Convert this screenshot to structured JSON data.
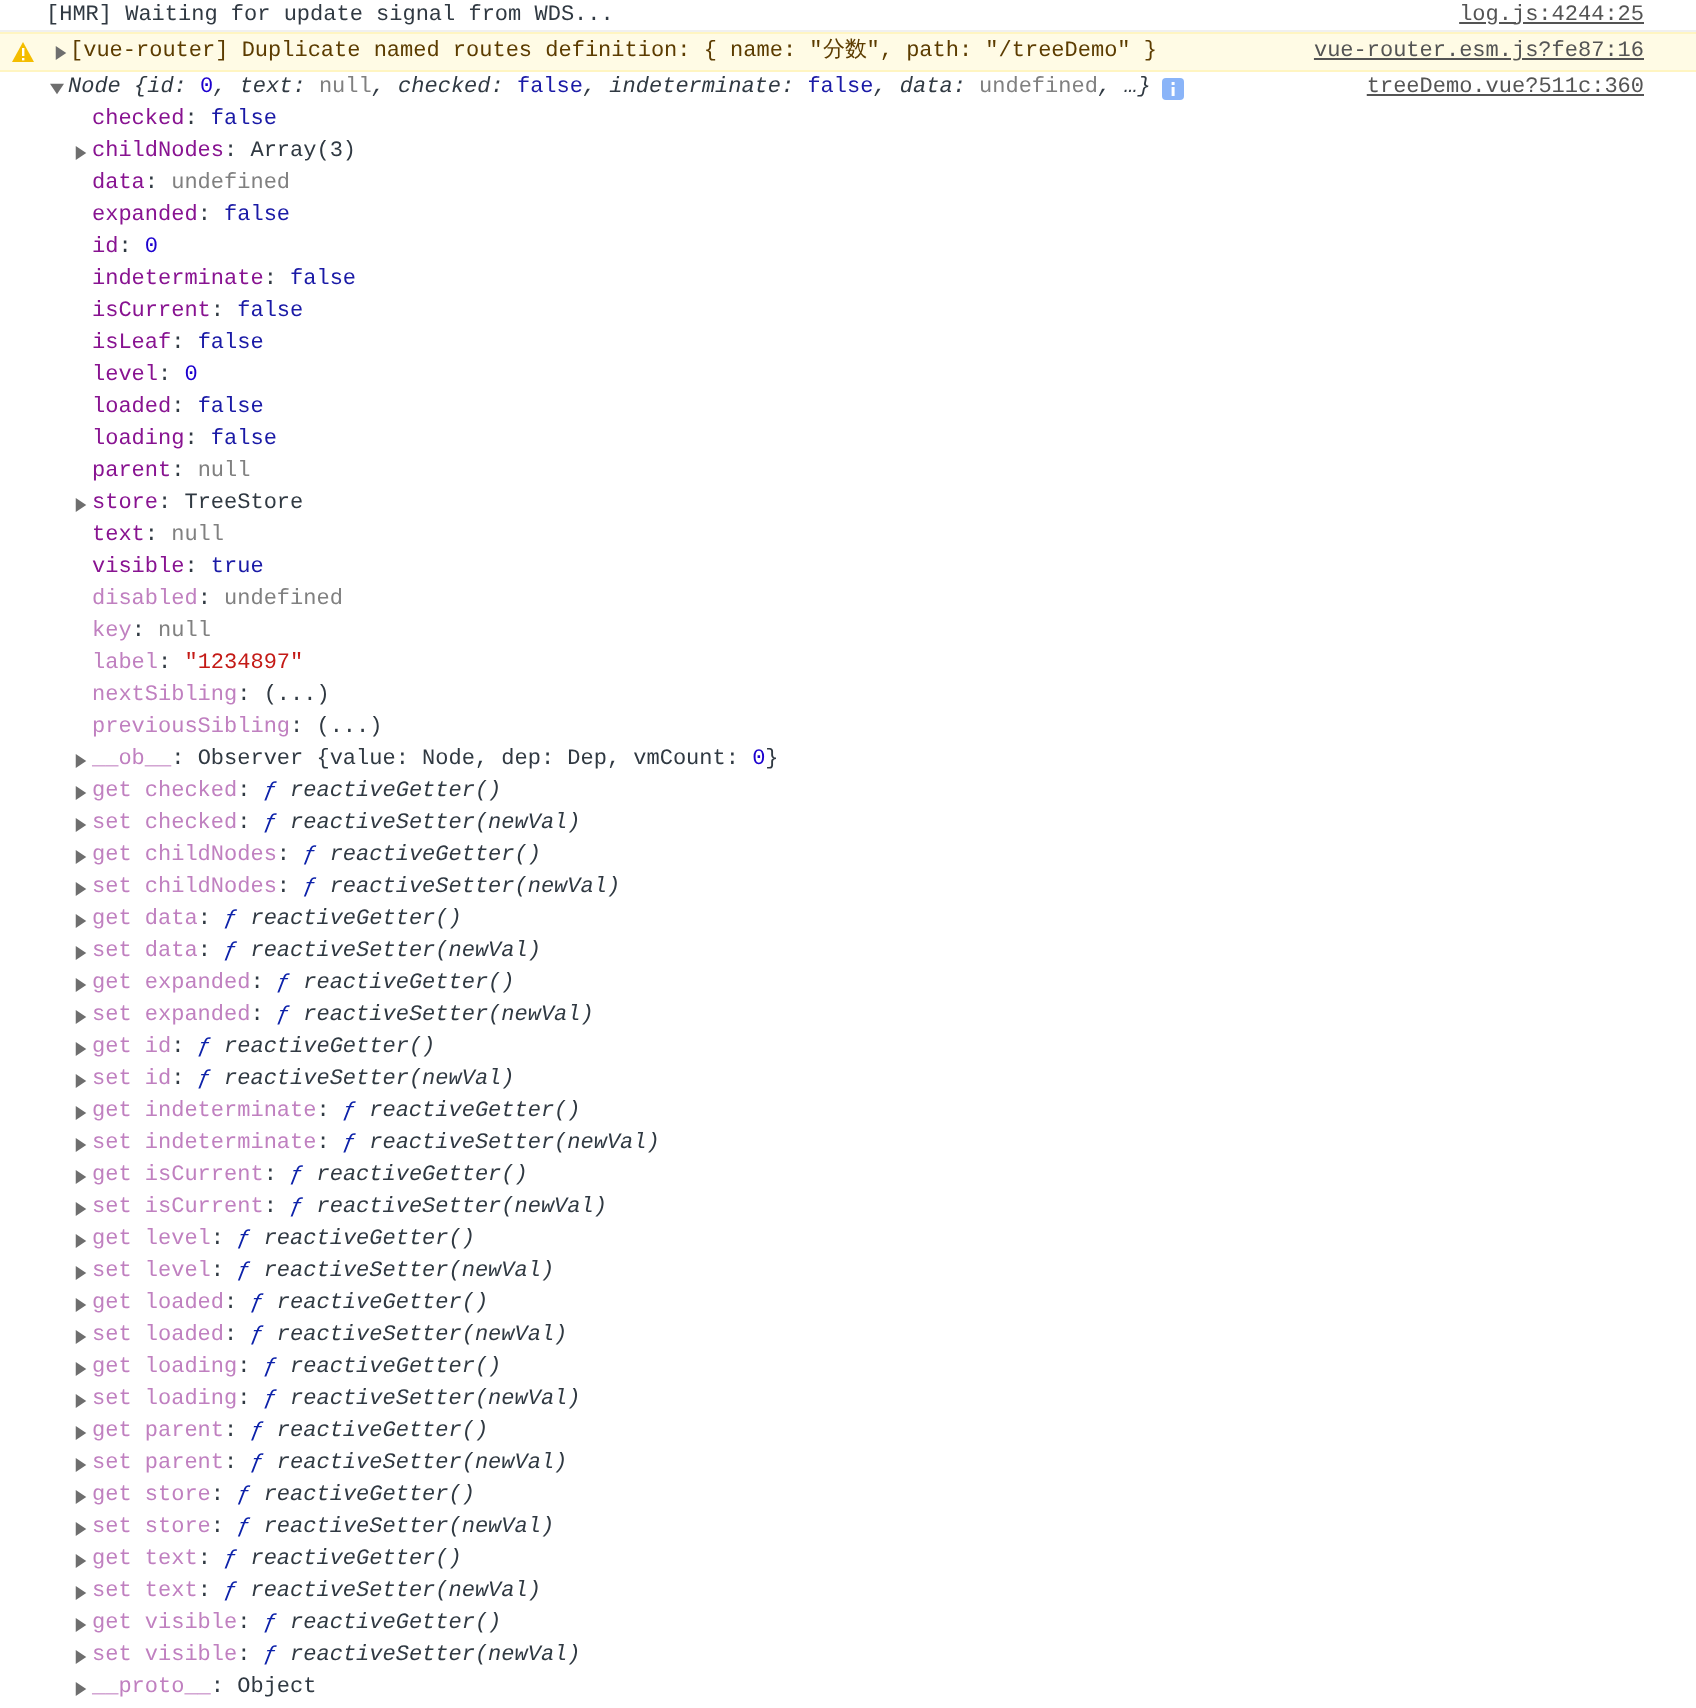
{
  "messages": [
    {
      "kind": "log",
      "text": "[HMR] Waiting for update signal from WDS...",
      "source": "log.js:4244:25"
    },
    {
      "kind": "warning",
      "expandable": true,
      "text": "[vue-router] Duplicate named routes definition: { name: \"分数\", path: \"/treeDemo\" }",
      "source": "vue-router.esm.js?fe87:16"
    },
    {
      "kind": "object",
      "expanded": true,
      "info": true,
      "source": "treeDemo.vue?511c:360",
      "summary": [
        {
          "kind": "cls",
          "text": "Node {"
        },
        {
          "kind": "pkey",
          "text": "id: "
        },
        {
          "kind": "num",
          "text": "0"
        },
        {
          "kind": "pkey",
          "text": ", text: "
        },
        {
          "kind": "null",
          "text": "null"
        },
        {
          "kind": "pkey",
          "text": ", checked: "
        },
        {
          "kind": "bool",
          "text": "false"
        },
        {
          "kind": "pkey",
          "text": ", indeterminate: "
        },
        {
          "kind": "bool",
          "text": "false"
        },
        {
          "kind": "pkey",
          "text": ", data: "
        },
        {
          "kind": "null",
          "text": "undefined"
        },
        {
          "kind": "pkey",
          "text": ", …}"
        }
      ],
      "properties": [
        {
          "expandable": false,
          "tokens": [
            {
              "kind": "key",
              "text": "checked"
            },
            {
              "kind": "punct",
              "text": ": "
            },
            {
              "kind": "bool",
              "text": "false"
            }
          ]
        },
        {
          "expandable": true,
          "tokens": [
            {
              "kind": "key",
              "text": "childNodes"
            },
            {
              "kind": "punct",
              "text": ": "
            },
            {
              "kind": "obj",
              "text": "Array(3)"
            }
          ]
        },
        {
          "expandable": false,
          "tokens": [
            {
              "kind": "key",
              "text": "data"
            },
            {
              "kind": "punct",
              "text": ": "
            },
            {
              "kind": "null",
              "text": "undefined"
            }
          ]
        },
        {
          "expandable": false,
          "tokens": [
            {
              "kind": "key",
              "text": "expanded"
            },
            {
              "kind": "punct",
              "text": ": "
            },
            {
              "kind": "bool",
              "text": "false"
            }
          ]
        },
        {
          "expandable": false,
          "tokens": [
            {
              "kind": "key",
              "text": "id"
            },
            {
              "kind": "punct",
              "text": ": "
            },
            {
              "kind": "num",
              "text": "0"
            }
          ]
        },
        {
          "expandable": false,
          "tokens": [
            {
              "kind": "key",
              "text": "indeterminate"
            },
            {
              "kind": "punct",
              "text": ": "
            },
            {
              "kind": "bool",
              "text": "false"
            }
          ]
        },
        {
          "expandable": false,
          "tokens": [
            {
              "kind": "key",
              "text": "isCurrent"
            },
            {
              "kind": "punct",
              "text": ": "
            },
            {
              "kind": "bool",
              "text": "false"
            }
          ]
        },
        {
          "expandable": false,
          "tokens": [
            {
              "kind": "key",
              "text": "isLeaf"
            },
            {
              "kind": "punct",
              "text": ": "
            },
            {
              "kind": "bool",
              "text": "false"
            }
          ]
        },
        {
          "expandable": false,
          "tokens": [
            {
              "kind": "key",
              "text": "level"
            },
            {
              "kind": "punct",
              "text": ": "
            },
            {
              "kind": "num",
              "text": "0"
            }
          ]
        },
        {
          "expandable": false,
          "tokens": [
            {
              "kind": "key",
              "text": "loaded"
            },
            {
              "kind": "punct",
              "text": ": "
            },
            {
              "kind": "bool",
              "text": "false"
            }
          ]
        },
        {
          "expandable": false,
          "tokens": [
            {
              "kind": "key",
              "text": "loading"
            },
            {
              "kind": "punct",
              "text": ": "
            },
            {
              "kind": "bool",
              "text": "false"
            }
          ]
        },
        {
          "expandable": false,
          "tokens": [
            {
              "kind": "key",
              "text": "parent"
            },
            {
              "kind": "punct",
              "text": ": "
            },
            {
              "kind": "null",
              "text": "null"
            }
          ]
        },
        {
          "expandable": true,
          "tokens": [
            {
              "kind": "key",
              "text": "store"
            },
            {
              "kind": "punct",
              "text": ": "
            },
            {
              "kind": "obj",
              "text": "TreeStore"
            }
          ]
        },
        {
          "expandable": false,
          "tokens": [
            {
              "kind": "key",
              "text": "text"
            },
            {
              "kind": "punct",
              "text": ": "
            },
            {
              "kind": "null",
              "text": "null"
            }
          ]
        },
        {
          "expandable": false,
          "tokens": [
            {
              "kind": "key",
              "text": "visible"
            },
            {
              "kind": "punct",
              "text": ": "
            },
            {
              "kind": "bool",
              "text": "true"
            }
          ]
        },
        {
          "expandable": false,
          "tokens": [
            {
              "kind": "dimkey",
              "text": "disabled"
            },
            {
              "kind": "punct",
              "text": ": "
            },
            {
              "kind": "null",
              "text": "undefined"
            }
          ]
        },
        {
          "expandable": false,
          "tokens": [
            {
              "kind": "dimkey",
              "text": "key"
            },
            {
              "kind": "punct",
              "text": ": "
            },
            {
              "kind": "null",
              "text": "null"
            }
          ]
        },
        {
          "expandable": false,
          "tokens": [
            {
              "kind": "dimkey",
              "text": "label"
            },
            {
              "kind": "punct",
              "text": ": "
            },
            {
              "kind": "str",
              "text": "\"1234897\""
            }
          ]
        },
        {
          "expandable": false,
          "tokens": [
            {
              "kind": "dimkey",
              "text": "nextSibling"
            },
            {
              "kind": "punct",
              "text": ": "
            },
            {
              "kind": "obj",
              "text": "(...)"
            }
          ]
        },
        {
          "expandable": false,
          "tokens": [
            {
              "kind": "dimkey",
              "text": "previousSibling"
            },
            {
              "kind": "punct",
              "text": ": "
            },
            {
              "kind": "obj",
              "text": "(...)"
            }
          ]
        },
        {
          "expandable": true,
          "tokens": [
            {
              "kind": "dimkey",
              "text": "__ob__"
            },
            {
              "kind": "punct",
              "text": ": "
            },
            {
              "kind": "obj",
              "text": "Observer {value: Node, dep: Dep, vmCount: "
            },
            {
              "kind": "num",
              "text": "0"
            },
            {
              "kind": "obj",
              "text": "}"
            }
          ]
        },
        {
          "expandable": true,
          "tokens": [
            {
              "kind": "dimkey",
              "text": "get checked"
            },
            {
              "kind": "punct",
              "text": ": "
            },
            {
              "kind": "fn",
              "text": "ƒ"
            },
            {
              "kind": "fnbody",
              "text": " reactiveGetter()"
            }
          ]
        },
        {
          "expandable": true,
          "tokens": [
            {
              "kind": "dimkey",
              "text": "set checked"
            },
            {
              "kind": "punct",
              "text": ": "
            },
            {
              "kind": "fn",
              "text": "ƒ"
            },
            {
              "kind": "fnbody",
              "text": " reactiveSetter(newVal)"
            }
          ]
        },
        {
          "expandable": true,
          "tokens": [
            {
              "kind": "dimkey",
              "text": "get childNodes"
            },
            {
              "kind": "punct",
              "text": ": "
            },
            {
              "kind": "fn",
              "text": "ƒ"
            },
            {
              "kind": "fnbody",
              "text": " reactiveGetter()"
            }
          ]
        },
        {
          "expandable": true,
          "tokens": [
            {
              "kind": "dimkey",
              "text": "set childNodes"
            },
            {
              "kind": "punct",
              "text": ": "
            },
            {
              "kind": "fn",
              "text": "ƒ"
            },
            {
              "kind": "fnbody",
              "text": " reactiveSetter(newVal)"
            }
          ]
        },
        {
          "expandable": true,
          "tokens": [
            {
              "kind": "dimkey",
              "text": "get data"
            },
            {
              "kind": "punct",
              "text": ": "
            },
            {
              "kind": "fn",
              "text": "ƒ"
            },
            {
              "kind": "fnbody",
              "text": " reactiveGetter()"
            }
          ]
        },
        {
          "expandable": true,
          "tokens": [
            {
              "kind": "dimkey",
              "text": "set data"
            },
            {
              "kind": "punct",
              "text": ": "
            },
            {
              "kind": "fn",
              "text": "ƒ"
            },
            {
              "kind": "fnbody",
              "text": " reactiveSetter(newVal)"
            }
          ]
        },
        {
          "expandable": true,
          "tokens": [
            {
              "kind": "dimkey",
              "text": "get expanded"
            },
            {
              "kind": "punct",
              "text": ": "
            },
            {
              "kind": "fn",
              "text": "ƒ"
            },
            {
              "kind": "fnbody",
              "text": " reactiveGetter()"
            }
          ]
        },
        {
          "expandable": true,
          "tokens": [
            {
              "kind": "dimkey",
              "text": "set expanded"
            },
            {
              "kind": "punct",
              "text": ": "
            },
            {
              "kind": "fn",
              "text": "ƒ"
            },
            {
              "kind": "fnbody",
              "text": " reactiveSetter(newVal)"
            }
          ]
        },
        {
          "expandable": true,
          "tokens": [
            {
              "kind": "dimkey",
              "text": "get id"
            },
            {
              "kind": "punct",
              "text": ": "
            },
            {
              "kind": "fn",
              "text": "ƒ"
            },
            {
              "kind": "fnbody",
              "text": " reactiveGetter()"
            }
          ]
        },
        {
          "expandable": true,
          "tokens": [
            {
              "kind": "dimkey",
              "text": "set id"
            },
            {
              "kind": "punct",
              "text": ": "
            },
            {
              "kind": "fn",
              "text": "ƒ"
            },
            {
              "kind": "fnbody",
              "text": " reactiveSetter(newVal)"
            }
          ]
        },
        {
          "expandable": true,
          "tokens": [
            {
              "kind": "dimkey",
              "text": "get indeterminate"
            },
            {
              "kind": "punct",
              "text": ": "
            },
            {
              "kind": "fn",
              "text": "ƒ"
            },
            {
              "kind": "fnbody",
              "text": " reactiveGetter()"
            }
          ]
        },
        {
          "expandable": true,
          "tokens": [
            {
              "kind": "dimkey",
              "text": "set indeterminate"
            },
            {
              "kind": "punct",
              "text": ": "
            },
            {
              "kind": "fn",
              "text": "ƒ"
            },
            {
              "kind": "fnbody",
              "text": " reactiveSetter(newVal)"
            }
          ]
        },
        {
          "expandable": true,
          "tokens": [
            {
              "kind": "dimkey",
              "text": "get isCurrent"
            },
            {
              "kind": "punct",
              "text": ": "
            },
            {
              "kind": "fn",
              "text": "ƒ"
            },
            {
              "kind": "fnbody",
              "text": " reactiveGetter()"
            }
          ]
        },
        {
          "expandable": true,
          "tokens": [
            {
              "kind": "dimkey",
              "text": "set isCurrent"
            },
            {
              "kind": "punct",
              "text": ": "
            },
            {
              "kind": "fn",
              "text": "ƒ"
            },
            {
              "kind": "fnbody",
              "text": " reactiveSetter(newVal)"
            }
          ]
        },
        {
          "expandable": true,
          "tokens": [
            {
              "kind": "dimkey",
              "text": "get level"
            },
            {
              "kind": "punct",
              "text": ": "
            },
            {
              "kind": "fn",
              "text": "ƒ"
            },
            {
              "kind": "fnbody",
              "text": " reactiveGetter()"
            }
          ]
        },
        {
          "expandable": true,
          "tokens": [
            {
              "kind": "dimkey",
              "text": "set level"
            },
            {
              "kind": "punct",
              "text": ": "
            },
            {
              "kind": "fn",
              "text": "ƒ"
            },
            {
              "kind": "fnbody",
              "text": " reactiveSetter(newVal)"
            }
          ]
        },
        {
          "expandable": true,
          "tokens": [
            {
              "kind": "dimkey",
              "text": "get loaded"
            },
            {
              "kind": "punct",
              "text": ": "
            },
            {
              "kind": "fn",
              "text": "ƒ"
            },
            {
              "kind": "fnbody",
              "text": " reactiveGetter()"
            }
          ]
        },
        {
          "expandable": true,
          "tokens": [
            {
              "kind": "dimkey",
              "text": "set loaded"
            },
            {
              "kind": "punct",
              "text": ": "
            },
            {
              "kind": "fn",
              "text": "ƒ"
            },
            {
              "kind": "fnbody",
              "text": " reactiveSetter(newVal)"
            }
          ]
        },
        {
          "expandable": true,
          "tokens": [
            {
              "kind": "dimkey",
              "text": "get loading"
            },
            {
              "kind": "punct",
              "text": ": "
            },
            {
              "kind": "fn",
              "text": "ƒ"
            },
            {
              "kind": "fnbody",
              "text": " reactiveGetter()"
            }
          ]
        },
        {
          "expandable": true,
          "tokens": [
            {
              "kind": "dimkey",
              "text": "set loading"
            },
            {
              "kind": "punct",
              "text": ": "
            },
            {
              "kind": "fn",
              "text": "ƒ"
            },
            {
              "kind": "fnbody",
              "text": " reactiveSetter(newVal)"
            }
          ]
        },
        {
          "expandable": true,
          "tokens": [
            {
              "kind": "dimkey",
              "text": "get parent"
            },
            {
              "kind": "punct",
              "text": ": "
            },
            {
              "kind": "fn",
              "text": "ƒ"
            },
            {
              "kind": "fnbody",
              "text": " reactiveGetter()"
            }
          ]
        },
        {
          "expandable": true,
          "tokens": [
            {
              "kind": "dimkey",
              "text": "set parent"
            },
            {
              "kind": "punct",
              "text": ": "
            },
            {
              "kind": "fn",
              "text": "ƒ"
            },
            {
              "kind": "fnbody",
              "text": " reactiveSetter(newVal)"
            }
          ]
        },
        {
          "expandable": true,
          "tokens": [
            {
              "kind": "dimkey",
              "text": "get store"
            },
            {
              "kind": "punct",
              "text": ": "
            },
            {
              "kind": "fn",
              "text": "ƒ"
            },
            {
              "kind": "fnbody",
              "text": " reactiveGetter()"
            }
          ]
        },
        {
          "expandable": true,
          "tokens": [
            {
              "kind": "dimkey",
              "text": "set store"
            },
            {
              "kind": "punct",
              "text": ": "
            },
            {
              "kind": "fn",
              "text": "ƒ"
            },
            {
              "kind": "fnbody",
              "text": " reactiveSetter(newVal)"
            }
          ]
        },
        {
          "expandable": true,
          "tokens": [
            {
              "kind": "dimkey",
              "text": "get text"
            },
            {
              "kind": "punct",
              "text": ": "
            },
            {
              "kind": "fn",
              "text": "ƒ"
            },
            {
              "kind": "fnbody",
              "text": " reactiveGetter()"
            }
          ]
        },
        {
          "expandable": true,
          "tokens": [
            {
              "kind": "dimkey",
              "text": "set text"
            },
            {
              "kind": "punct",
              "text": ": "
            },
            {
              "kind": "fn",
              "text": "ƒ"
            },
            {
              "kind": "fnbody",
              "text": " reactiveSetter(newVal)"
            }
          ]
        },
        {
          "expandable": true,
          "tokens": [
            {
              "kind": "dimkey",
              "text": "get visible"
            },
            {
              "kind": "punct",
              "text": ": "
            },
            {
              "kind": "fn",
              "text": "ƒ"
            },
            {
              "kind": "fnbody",
              "text": " reactiveGetter()"
            }
          ]
        },
        {
          "expandable": true,
          "tokens": [
            {
              "kind": "dimkey",
              "text": "set visible"
            },
            {
              "kind": "punct",
              "text": ": "
            },
            {
              "kind": "fn",
              "text": "ƒ"
            },
            {
              "kind": "fnbody",
              "text": " reactiveSetter(newVal)"
            }
          ]
        },
        {
          "expandable": true,
          "tokens": [
            {
              "kind": "dimkey",
              "text": "__proto__"
            },
            {
              "kind": "punct",
              "text": ": "
            },
            {
              "kind": "obj",
              "text": "Object"
            }
          ]
        }
      ]
    }
  ]
}
